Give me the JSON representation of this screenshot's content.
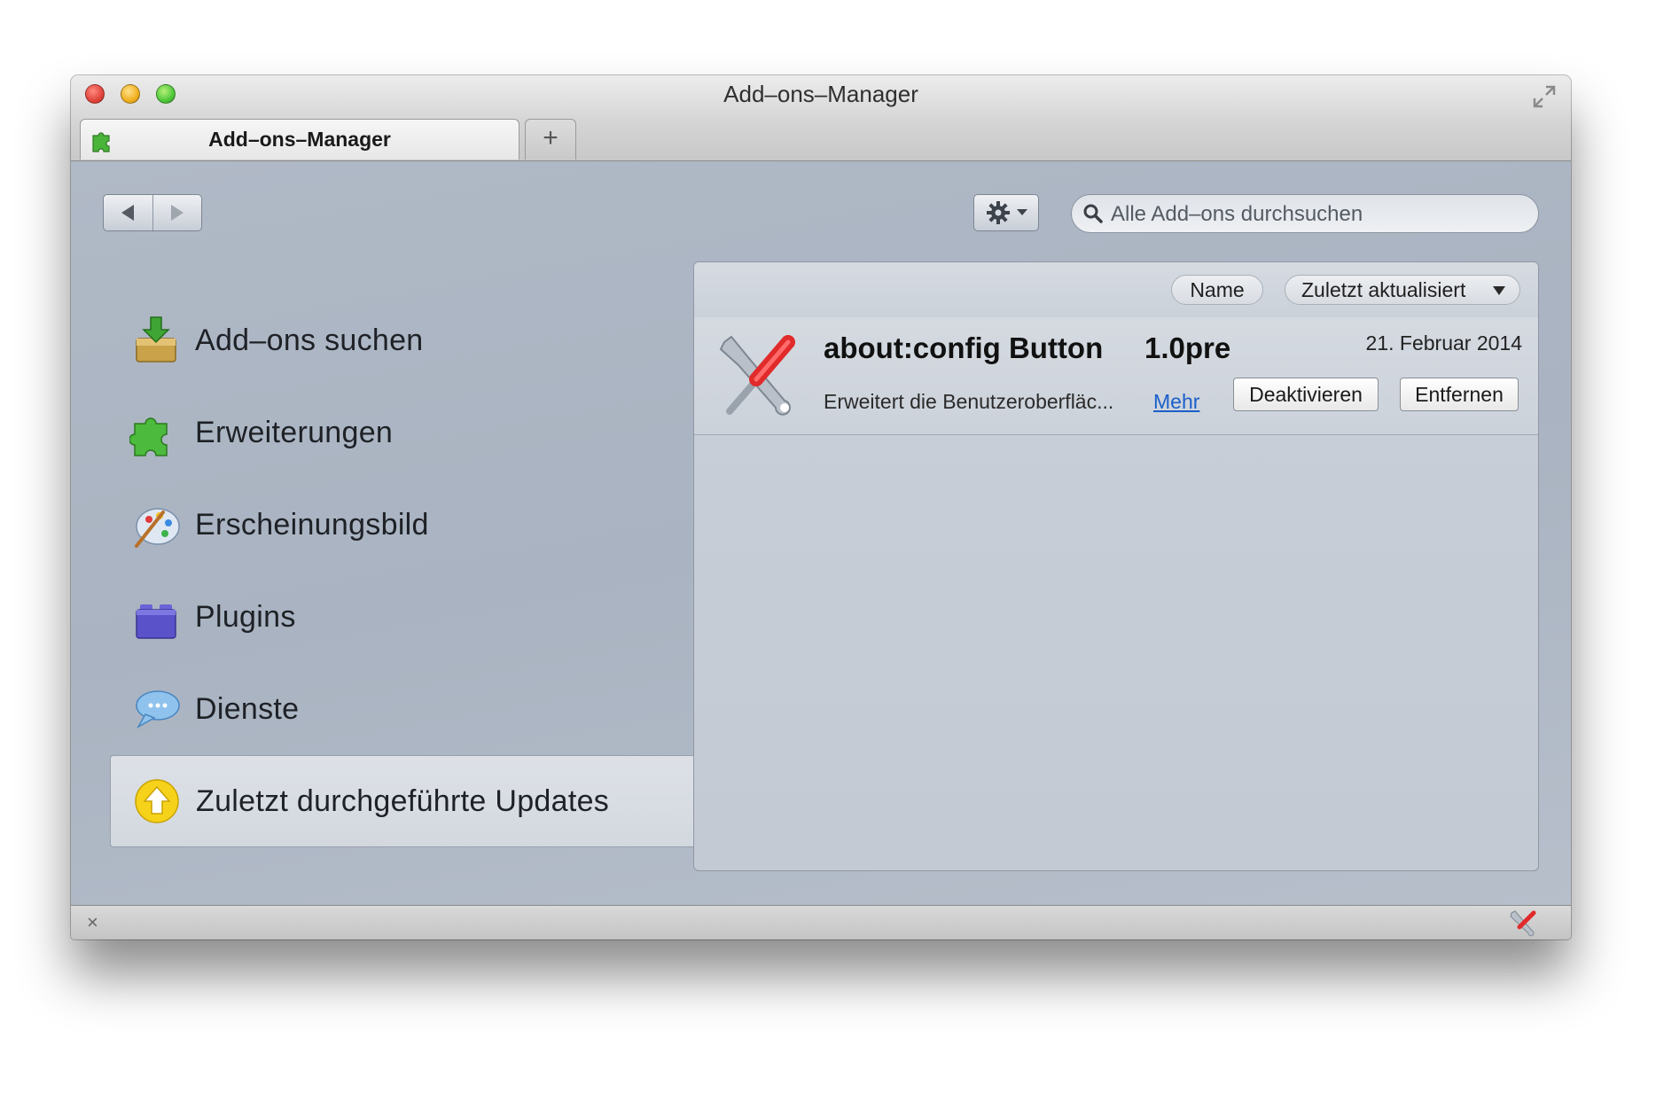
{
  "window": {
    "title": "Add–ons–Manager"
  },
  "tabs": [
    {
      "label": "Add–ons–Manager",
      "icon": "puzzle-icon"
    }
  ],
  "new_tab_label": "+",
  "toolbar": {
    "back_icon": "back-arrow-icon",
    "forward_icon": "forward-arrow-icon",
    "tools_icon": "gear-icon",
    "search_placeholder": "Alle Add–ons durchsuchen"
  },
  "sidebar": {
    "items": [
      {
        "label": "Add–ons suchen",
        "icon": "download-box-icon",
        "selected": false
      },
      {
        "label": "Erweiterungen",
        "icon": "puzzle-icon",
        "selected": false
      },
      {
        "label": "Erscheinungsbild",
        "icon": "palette-icon",
        "selected": false
      },
      {
        "label": "Plugins",
        "icon": "lego-brick-icon",
        "selected": false
      },
      {
        "label": "Dienste",
        "icon": "speech-bubble-icon",
        "selected": false
      },
      {
        "label": "Zuletzt durchgeführte Updates",
        "icon": "update-arrow-icon",
        "selected": true
      }
    ]
  },
  "sort": {
    "name_label": "Name",
    "updated_label": "Zuletzt aktualisiert"
  },
  "addons": [
    {
      "name": "about:config Button",
      "version": "1.0pre",
      "date": "21. Februar 2014",
      "description": "Erweitert die Benutzeroberfläc...",
      "more_label": "Mehr",
      "deactivate_label": "Deaktivieren",
      "remove_label": "Entfernen",
      "icon": "wrench-screwdriver-icon"
    }
  ],
  "statusbar": {
    "close_label": "×"
  },
  "colors": {
    "link": "#1a5fc9",
    "content_background": "#a9b3c1"
  }
}
